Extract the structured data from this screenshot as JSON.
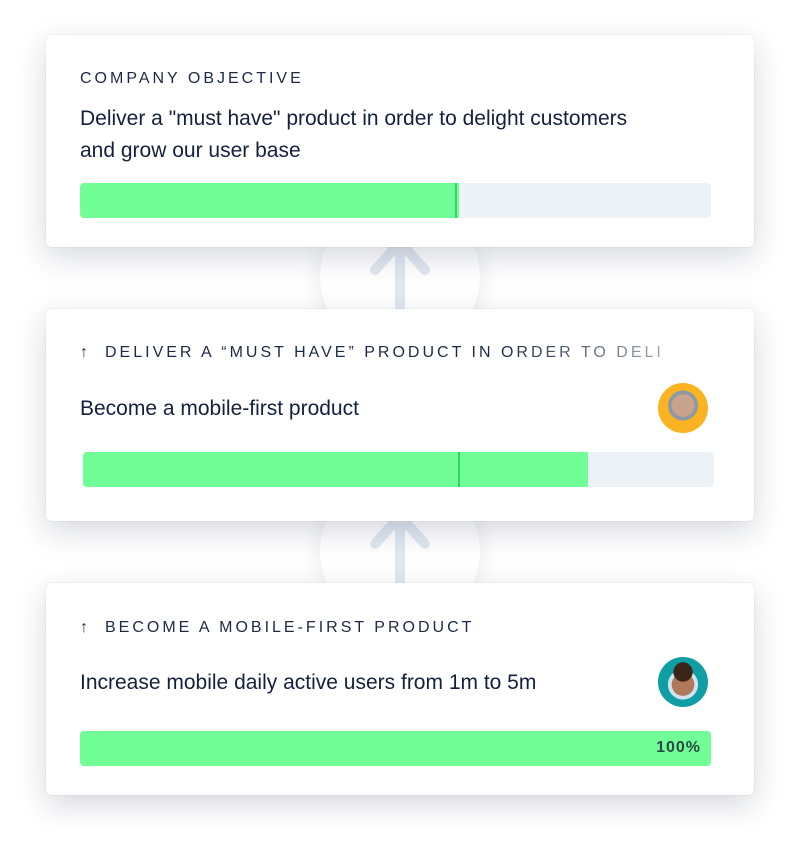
{
  "cards": [
    {
      "eyebrow": "COMPANY OBJECTIVE",
      "title": "Deliver a \"must have\" product in order to delight customers and grow our user base",
      "progress": 0.6
    },
    {
      "eyebrow": "DELIVER A “MUST HAVE” PRODUCT IN ORDER TO DELI",
      "title": "Become a mobile-first product",
      "progress": 0.8,
      "marker": 0.6,
      "avatar_color": "#fbb321",
      "avatar": "avatar-woman"
    },
    {
      "eyebrow": "BECOME A MOBILE-FIRST PRODUCT",
      "title": "Increase mobile daily active users from 1m to 5m",
      "progress": 1.0,
      "progress_label": "100%",
      "avatar_color": "#0e9ea3",
      "avatar": "avatar-man"
    }
  ],
  "colors": {
    "fill": "#72fe97",
    "track": "#edf2f7",
    "arrow": "#dfe8f0"
  }
}
